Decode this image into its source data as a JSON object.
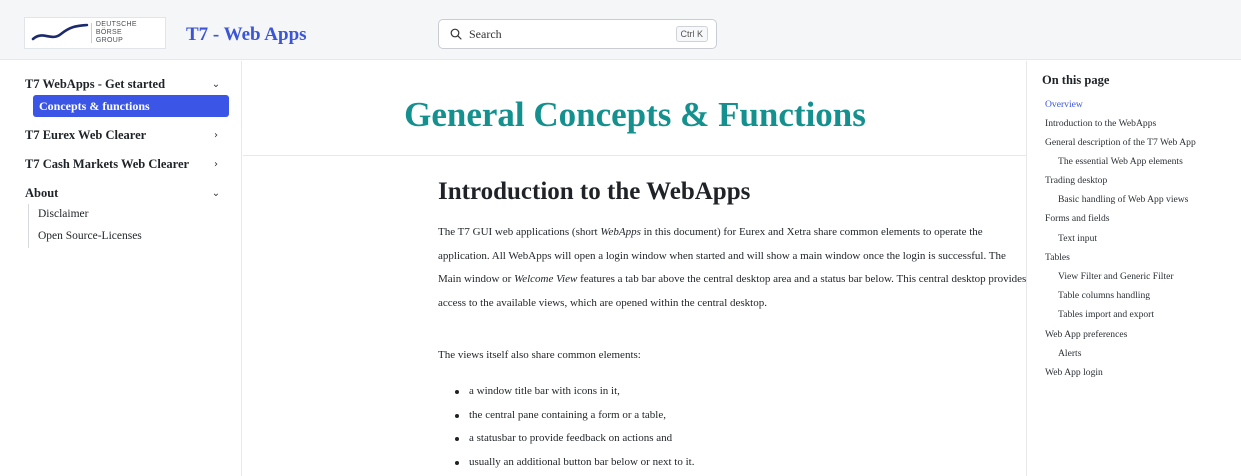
{
  "header": {
    "logo_text_line1": "DEUTSCHE BÖRSE",
    "logo_text_line2": "GROUP",
    "app_title": "T7 - Web Apps",
    "search_placeholder": "Search",
    "search_shortcut": "Ctrl K"
  },
  "sidebar": {
    "sections": [
      {
        "label": "T7 WebApps - Get started",
        "expanded": true,
        "chevron": "⌄"
      },
      {
        "label": "T7 Eurex Web Clearer",
        "expanded": false,
        "chevron": "›"
      },
      {
        "label": "T7 Cash Markets Web Clearer",
        "expanded": false,
        "chevron": "›"
      },
      {
        "label": "About",
        "expanded": true,
        "chevron": "⌄"
      }
    ],
    "active_item": "Concepts & functions",
    "about_items": [
      "Disclaimer",
      "Open Source-Licenses"
    ]
  },
  "main": {
    "page_title": "General Concepts & Functions",
    "section_heading": "Introduction to the WebApps",
    "para1": {
      "t1": "The T7 GUI web applications (short ",
      "em1": "WebApps",
      "t2": " in this document) for Eurex and Xetra share common elements to operate the application. All WebApps will open a login window when started and will show a main window once the login is successful. The Main window or ",
      "em2": "Welcome View",
      "t3": " features a tab bar above the central desktop area and a status bar below. This central desktop provides access to the available views, which are opened within the central desktop."
    },
    "para2": "The views itself also share common elements:",
    "bullets": [
      "a window title bar with icons in it,",
      "the central pane containing a form or a table,",
      "a statusbar to provide feedback on actions and",
      "usually an additional button bar below or next to it."
    ]
  },
  "toc": {
    "title": "On this page",
    "items": [
      {
        "label": "Overview",
        "level": 1,
        "active": true
      },
      {
        "label": "Introduction to the WebApps",
        "level": 1
      },
      {
        "label": "General description of the T7 Web App",
        "level": 1
      },
      {
        "label": "The essential Web App elements",
        "level": 2
      },
      {
        "label": "Trading desktop",
        "level": 1
      },
      {
        "label": "Basic handling of Web App views",
        "level": 2
      },
      {
        "label": "Forms and fields",
        "level": 1
      },
      {
        "label": "Text input",
        "level": 2
      },
      {
        "label": "Tables",
        "level": 1
      },
      {
        "label": "View Filter and Generic Filter",
        "level": 2
      },
      {
        "label": "Table columns handling",
        "level": 2
      },
      {
        "label": "Tables import and export",
        "level": 2
      },
      {
        "label": "Web App preferences",
        "level": 1
      },
      {
        "label": "Alerts",
        "level": 2
      },
      {
        "label": "Web App login",
        "level": 1
      }
    ]
  },
  "colors": {
    "accent": "#3b55e6",
    "title_teal": "#14918e",
    "header_bg": "#f5f6f7"
  }
}
